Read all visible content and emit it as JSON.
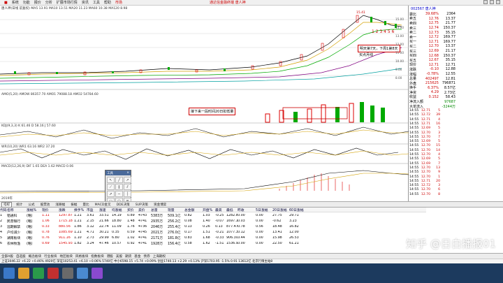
{
  "menu": {
    "items": [
      "系统",
      "功能",
      "报价",
      "分析",
      "扩展市场行情",
      "资讯",
      "工具",
      "帮助"
    ],
    "title": "通达信金融终端 唐人神",
    "market_tab": "市场"
  },
  "chart": {
    "main_header": "唐人神(日线 前复权) MA5 13.91 MA10 13.51 MA20 11.23 MA60 10.38 MA120 8.98",
    "high_label": "15.41",
    "annot1": "明天第7天，下周1第8天",
    "annot2": "买点月线",
    "wave_labels": "1 2 3 4 5 6",
    "amo_header": "AMO(5,20) AMOW 86357.70 AMO1 79088.18 AMO2 54784.60",
    "amo_annot": "接下来一段时间20日扣低量",
    "kdj_header": "KDJ(9,3,3) K 61.46 D 58.16 J 57.60",
    "wr_header": "WR(10,20) WR1 63.16 WR2 37.20",
    "macd_header": "MACD(12,26,9) DIF 1.65 DEA 1.62 MACD 0.06",
    "y_labels": [
      "15.00",
      "14.00",
      "13.00",
      "12.00",
      "11.00",
      "10.00",
      "9.00",
      "8.00"
    ],
    "date_label": "2019年"
  },
  "quote": {
    "code": "002567 唐人神",
    "rows": [
      {
        "l": "委比",
        "p": "39.68%",
        "v": "2364"
      },
      {
        "l": "卖五",
        "p": "12.76",
        "v": "13.37"
      },
      {
        "l": "卖四",
        "p": "12.75",
        "v": "21.77"
      },
      {
        "l": "卖三",
        "p": "12.74",
        "v": "150.37"
      },
      {
        "l": "卖二",
        "p": "12.73",
        "v": "35.15"
      },
      {
        "l": "卖一",
        "p": "12.72",
        "v": "169.77"
      },
      {
        "l": "买一",
        "p": "12.71",
        "v": "169.77"
      },
      {
        "l": "买二",
        "p": "12.70",
        "v": "13.37"
      },
      {
        "l": "买三",
        "p": "12.69",
        "v": "21.17"
      },
      {
        "l": "买四",
        "p": "12.68",
        "v": "150.37"
      },
      {
        "l": "买五",
        "p": "12.67",
        "v": "35.15"
      },
      {
        "l": "现价",
        "p": "12.71",
        "v": "12.71"
      },
      {
        "l": "涨跌",
        "p": "-0.10",
        "v": "12.88"
      },
      {
        "l": "涨幅",
        "p": "-0.78%",
        "v": "12.55"
      },
      {
        "l": "总量",
        "p": "402497",
        "v": "12.81"
      },
      {
        "l": "外盘",
        "p": "215625",
        "v": "796871"
      },
      {
        "l": "换手",
        "p": "6.37%",
        "v": "8.57亿"
      },
      {
        "l": "净资",
        "p": "4.29",
        "v": "2.73亿"
      },
      {
        "l": "收益",
        "p": "0.152",
        "v": "58.43"
      }
    ],
    "flow_in": "净流入额",
    "flow_in_v": "97687",
    "flow_big": "大单流入",
    "flow_big_v": "-3244万",
    "ticks": [
      [
        "14:55",
        "12.71",
        "5"
      ],
      [
        "14:55",
        "12.72",
        "39"
      ],
      [
        "14:55",
        "12.71",
        "4"
      ],
      [
        "14:55",
        "12.71",
        "16"
      ],
      [
        "14:55",
        "12.69",
        "5"
      ],
      [
        "14:55",
        "12.70",
        "3"
      ],
      [
        "14:55",
        "12.70",
        "7"
      ],
      [
        "14:55",
        "12.69",
        "5"
      ],
      [
        "14:55",
        "12.70",
        "15"
      ],
      [
        "14:55",
        "12.70",
        "14"
      ],
      [
        "14:55",
        "12.70",
        "4"
      ],
      [
        "14:55",
        "12.69",
        "5"
      ],
      [
        "14:55",
        "12.69",
        "7"
      ],
      [
        "14:55",
        "12.70",
        "13"
      ],
      [
        "14:55",
        "12.70",
        "9"
      ],
      [
        "14:55",
        "12.70",
        "1"
      ],
      [
        "14:55",
        "12.71",
        "20"
      ],
      [
        "14:55",
        "12.72",
        "3"
      ],
      [
        "14:55",
        "12.70",
        "6"
      ],
      [
        "14:55",
        "12.70",
        "8"
      ]
    ]
  },
  "tabs": [
    "指标",
    "统计",
    "公式",
    "股票池",
    "涨跌幅",
    "振幅",
    "量比",
    "MACD金叉",
    "DDE决策",
    "SUP决策",
    "资金博弈"
  ],
  "table": {
    "headers": [
      "代码",
      "名称",
      "涨幅%",
      "现价",
      "涨跌",
      "换手%",
      "市盈",
      "涨速",
      "均涨幅",
      "买价",
      "卖价",
      "总量",
      "现量",
      "总金额",
      "开盘%",
      "最高",
      "最低",
      "昨收",
      "5日涨幅",
      "20日涨幅",
      "60日涨幅"
    ],
    "rows": [
      [
        "1",
        "铝通科",
        "(略)",
        "1.11",
        "1297.87",
        "1.21",
        "3.61",
        "33.51",
        "14.19",
        "0.89",
        "4743",
        "5383万",
        "509.1亿",
        "0.82",
        "1.03",
        "-0.25",
        "1282.89",
        "0.00",
        "0.00",
        "27.75",
        "29.71"
      ],
      [
        "2",
        "民营银行",
        "(略)",
        "1.06",
        "1715.18",
        "1.21",
        "2.15",
        "21.66",
        "18.80",
        "1.48",
        "4741",
        "2935万",
        "256.2亿",
        "0.08",
        "1.40",
        "-0.07",
        "1697.19",
        "0.03",
        "0.00",
        "-0.62",
        "3.23"
      ],
      [
        "3",
        "远期解禁",
        "(略)",
        "0.33",
        "880.56",
        "1.86",
        "3.12",
        "22.74",
        "11.09",
        "1.76",
        "4736",
        "2046万",
        "255.4亿",
        "0.13",
        "0.26",
        "0.13",
        "877.47",
        "0.78",
        "0.56",
        "18.48",
        "16.82"
      ],
      [
        "4",
        "户均减少",
        "(略)",
        "0.78",
        "1085.69",
        "1.21",
        "4.71",
        "30.21",
        "0.35",
        "0.59",
        "4745",
        "2021万",
        "276.0亿",
        "0.17",
        "1.51",
        "-0.21",
        "1077.34",
        "0.12",
        "0.00",
        "13.41",
        "12.00"
      ],
      [
        "5",
        "湖南板块",
        "(略)",
        "0.76",
        "911.16",
        "1.10",
        "2.73",
        "29.99",
        "6.80",
        "1.02",
        "4741",
        "2171万",
        "181.8亿",
        "0.83",
        "1.68",
        "-0.33",
        "906.30",
        "0.44",
        "0.00",
        "15.98",
        "26.53"
      ],
      [
        "6",
        "农林牧渔",
        "(略)",
        "0.69",
        "1545.93",
        "1.82",
        "3.24",
        "47.46",
        "10.57",
        "0.92",
        "4741",
        "1928万",
        "156.4亿",
        "0.58",
        "1.62",
        "-1.51",
        "1536.96",
        "0.00",
        "0.00",
        "22.50",
        "61.21"
      ]
    ]
  },
  "bottomtabs": [
    "全部A股",
    "自选股",
    "概念板块",
    "行业板块",
    "地区板块",
    "风格板块",
    "指数板块",
    "港股",
    "美股",
    "期货",
    "基金",
    "债券",
    "上海期权"
  ],
  "status": "上证3046.22  +6.22  +0.46%  4920亿   深证10253.41  +6.10  +0.06%  5740亿   中小6598.15  +5.74  +0.09%   创业1740.13  +2.29  +0.13%   沪深1703.95  -1.5%  0.91   13612亿   北京行情主站8",
  "watermark": "知乎 @日白播报01",
  "colors": {
    "up": "#d00000",
    "down": "#008000",
    "taskbar": "#1c3a5e"
  }
}
